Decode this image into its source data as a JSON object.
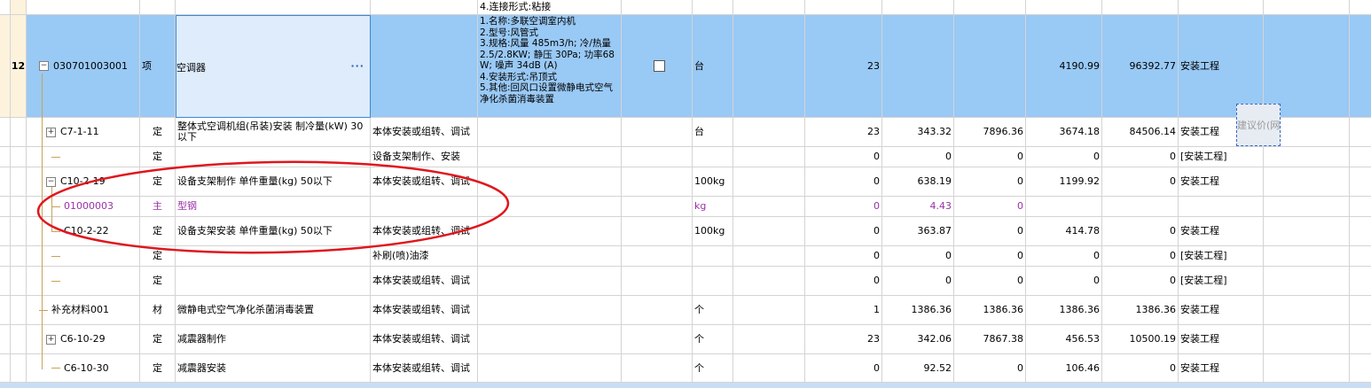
{
  "rows": [
    {
      "no": "",
      "code": "",
      "type": "",
      "name": "",
      "work": "",
      "feature": "4.连接形式:粘接",
      "unit": "",
      "qty": "",
      "price": "",
      "labor": "",
      "subtotal": "",
      "total": "",
      "cat": ""
    },
    {
      "no": "12",
      "code": "030701003001",
      "type": "项",
      "name": "空调器",
      "work": "",
      "feature": "1.名称:多联空调室内机\n2.型号:风管式\n3.规格:风量 485m3/h; 冷/热量2.5/2.8KW; 静压 30Pa; 功率68W; 噪声 34dB (A)\n4.安装形式:吊顶式\n5.其他:回风口设置微静电式空气净化杀菌消毒装置",
      "unit": "台",
      "qty": "23",
      "price": "",
      "labor": "",
      "subtotal": "4190.99",
      "total": "96392.77",
      "cat": "安装工程"
    },
    {
      "no": "",
      "code": "C7-1-11",
      "type": "定",
      "name": "整体式空调机组(吊装)安装 制冷量(kW) 30以下",
      "work": "本体安装或组转、调试",
      "feature": "",
      "unit": "台",
      "qty": "23",
      "price": "343.32",
      "labor": "7896.36",
      "subtotal": "3674.18",
      "total": "84506.14",
      "cat": "安装工程"
    },
    {
      "no": "",
      "code": "",
      "type": "定",
      "name": "",
      "work": "设备支架制作、安装",
      "feature": "",
      "unit": "",
      "qty": "0",
      "price": "0",
      "labor": "0",
      "subtotal": "0",
      "total": "0",
      "cat": "[安装工程]"
    },
    {
      "no": "",
      "code": "C10-2-19",
      "type": "定",
      "name": "设备支架制作 单件重量(kg) 50以下",
      "work": "本体安装或组转、调试",
      "feature": "",
      "unit": "100kg",
      "qty": "0",
      "price": "638.19",
      "labor": "0",
      "subtotal": "1199.92",
      "total": "0",
      "cat": "安装工程"
    },
    {
      "no": "",
      "code": "01000003",
      "type": "主",
      "name": "型钢",
      "work": "",
      "feature": "",
      "unit": "kg",
      "qty": "0",
      "price": "4.43",
      "labor": "0",
      "subtotal": "",
      "total": "",
      "cat": ""
    },
    {
      "no": "",
      "code": "C10-2-22",
      "type": "定",
      "name": "设备支架安装 单件重量(kg) 50以下",
      "work": "本体安装或组转、调试",
      "feature": "",
      "unit": "100kg",
      "qty": "0",
      "price": "363.87",
      "labor": "0",
      "subtotal": "414.78",
      "total": "0",
      "cat": "安装工程"
    },
    {
      "no": "",
      "code": "",
      "type": "定",
      "name": "",
      "work": "补刷(喷)油漆",
      "feature": "",
      "unit": "",
      "qty": "0",
      "price": "0",
      "labor": "0",
      "subtotal": "0",
      "total": "0",
      "cat": "[安装工程]"
    },
    {
      "no": "",
      "code": "",
      "type": "定",
      "name": "",
      "work": "本体安装或组转、调试",
      "feature": "",
      "unit": "",
      "qty": "0",
      "price": "0",
      "labor": "0",
      "subtotal": "0",
      "total": "0",
      "cat": "[安装工程]"
    },
    {
      "no": "",
      "code": "补充材料001",
      "type": "材",
      "name": "微静电式空气净化杀菌消毒装置",
      "work": "本体安装或组转、调试",
      "feature": "",
      "unit": "个",
      "qty": "1",
      "price": "1386.36",
      "labor": "1386.36",
      "subtotal": "1386.36",
      "total": "1386.36",
      "cat": "安装工程"
    },
    {
      "no": "",
      "code": "C6-10-29",
      "type": "定",
      "name": "减震器制作",
      "work": "本体安装或组转、调试",
      "feature": "",
      "unit": "个",
      "qty": "23",
      "price": "342.06",
      "labor": "7867.38",
      "subtotal": "456.53",
      "total": "10500.19",
      "cat": "安装工程"
    },
    {
      "no": "",
      "code": "C6-10-30",
      "type": "定",
      "name": "减震器安装",
      "work": "本体安装或组转、调试",
      "feature": "",
      "unit": "个",
      "qty": "0",
      "price": "92.52",
      "labor": "0",
      "subtotal": "106.46",
      "total": "0",
      "cat": "安装工程"
    }
  ],
  "editor": {
    "value": "空调器",
    "button_label": "···"
  },
  "tooltip": {
    "text": "建议价(网"
  },
  "colors": {
    "selected_row": "#99c9f5",
    "sub_item_text": "#9b30a8",
    "annotation_ellipse": "#e0161d",
    "row_number_bg": "#fdf2dc"
  }
}
